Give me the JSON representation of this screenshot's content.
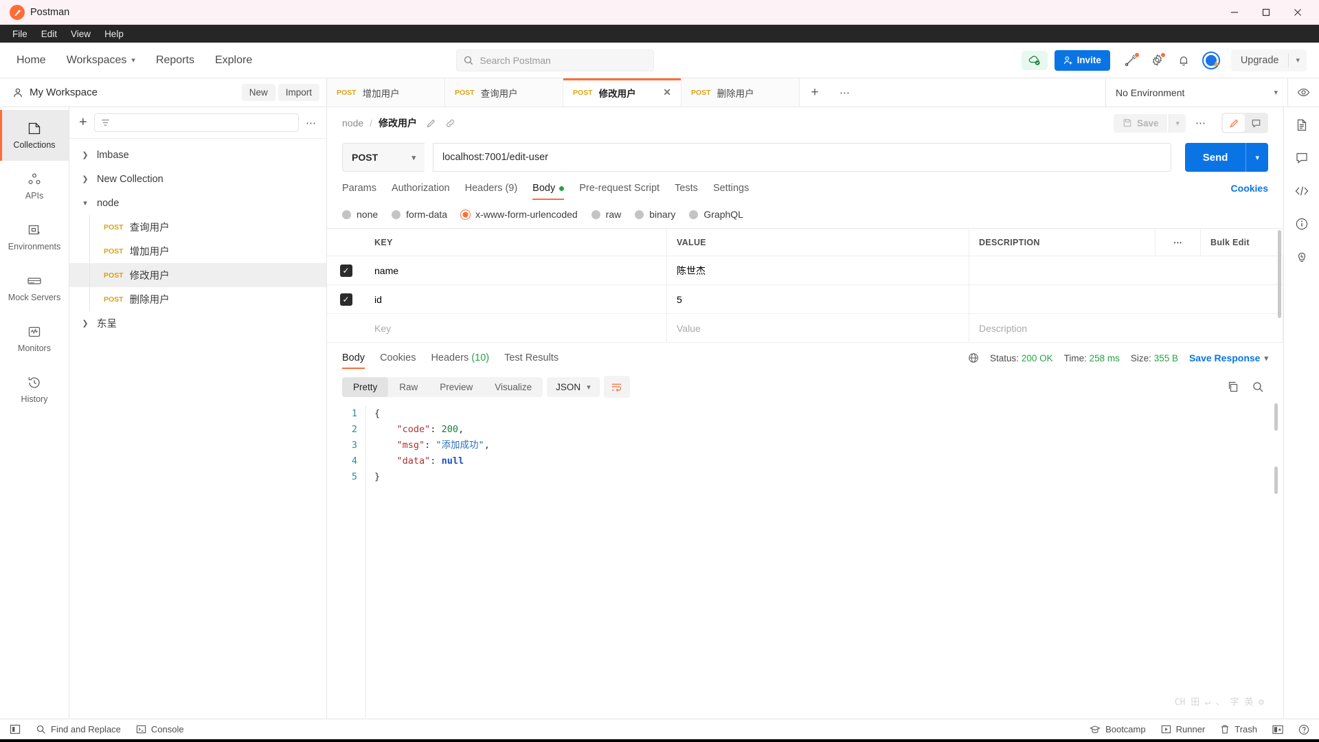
{
  "window": {
    "title": "Postman",
    "controls": {
      "minimize": "—",
      "maximize": "☐",
      "close": "✕"
    }
  },
  "menubar": {
    "items": [
      "File",
      "Edit",
      "View",
      "Help"
    ]
  },
  "topnav": {
    "links": [
      {
        "label": "Home",
        "has_caret": false
      },
      {
        "label": "Workspaces",
        "has_caret": true
      },
      {
        "label": "Reports",
        "has_caret": false
      },
      {
        "label": "Explore",
        "has_caret": false
      }
    ],
    "search": {
      "placeholder": "Search Postman",
      "value": ""
    },
    "invite_label": "Invite",
    "upgrade_label": "Upgrade",
    "icons": [
      "cloud-sync-icon",
      "broadcast-icon",
      "gear-icon",
      "bell-icon",
      "avatar-icon"
    ]
  },
  "workspace": {
    "name": "My Workspace",
    "new_label": "New",
    "import_label": "Import"
  },
  "tabs": [
    {
      "method": "POST",
      "name": "增加用户",
      "active": false
    },
    {
      "method": "POST",
      "name": "查询用户",
      "active": false
    },
    {
      "method": "POST",
      "name": "修改用户",
      "active": true
    },
    {
      "method": "POST",
      "name": "删除用户",
      "active": false
    }
  ],
  "environment": {
    "selected": "No Environment"
  },
  "left_rail": [
    {
      "label": "Collections",
      "icon": "collections-icon",
      "active": true
    },
    {
      "label": "APIs",
      "icon": "apis-icon",
      "active": false
    },
    {
      "label": "Environments",
      "icon": "environments-icon",
      "active": false
    },
    {
      "label": "Mock Servers",
      "icon": "mock-servers-icon",
      "active": false
    },
    {
      "label": "Monitors",
      "icon": "monitors-icon",
      "active": false
    },
    {
      "label": "History",
      "icon": "history-icon",
      "active": false
    }
  ],
  "sidebar": {
    "filter_placeholder": "",
    "tree": [
      {
        "type": "collection",
        "label": "lmbase",
        "expanded": false
      },
      {
        "type": "collection",
        "label": "New Collection",
        "expanded": false
      },
      {
        "type": "collection",
        "label": "node",
        "expanded": true
      },
      {
        "type": "request",
        "method": "POST",
        "label": "查询用户",
        "selected": false
      },
      {
        "type": "request",
        "method": "POST",
        "label": "增加用户",
        "selected": false
      },
      {
        "type": "request",
        "method": "POST",
        "label": "修改用户",
        "selected": true
      },
      {
        "type": "request",
        "method": "POST",
        "label": "删除用户",
        "selected": false
      },
      {
        "type": "collection",
        "label": "东呈",
        "expanded": false
      }
    ]
  },
  "request": {
    "breadcrumb_collection": "node",
    "breadcrumb_sep": "/",
    "breadcrumb_name": "修改用户",
    "save_label": "Save",
    "method": "POST",
    "url": "localhost:7001/edit-user",
    "send_label": "Send",
    "tabs": [
      {
        "label": "Params",
        "active": false,
        "dot": false
      },
      {
        "label": "Authorization",
        "active": false,
        "dot": false
      },
      {
        "label": "Headers (9)",
        "active": false,
        "dot": false
      },
      {
        "label": "Body",
        "active": true,
        "dot": true
      },
      {
        "label": "Pre-request Script",
        "active": false,
        "dot": false
      },
      {
        "label": "Tests",
        "active": false,
        "dot": false
      },
      {
        "label": "Settings",
        "active": false,
        "dot": false
      }
    ],
    "cookies_link": "Cookies",
    "body_types": [
      {
        "label": "none",
        "selected": false
      },
      {
        "label": "form-data",
        "selected": false
      },
      {
        "label": "x-www-form-urlencoded",
        "selected": true
      },
      {
        "label": "raw",
        "selected": false
      },
      {
        "label": "binary",
        "selected": false
      },
      {
        "label": "GraphQL",
        "selected": false
      }
    ],
    "table": {
      "headers": [
        "KEY",
        "VALUE",
        "DESCRIPTION"
      ],
      "bulk_edit_label": "Bulk Edit",
      "rows": [
        {
          "checked": true,
          "key": "name",
          "value": "陈世杰",
          "description": ""
        },
        {
          "checked": true,
          "key": "id",
          "value": "5",
          "description": ""
        }
      ],
      "placeholder_row": {
        "key": "Key",
        "value": "Value",
        "description": "Description"
      }
    }
  },
  "response": {
    "tabs": [
      {
        "label": "Body",
        "count": "",
        "active": true
      },
      {
        "label": "Cookies",
        "count": "",
        "active": false
      },
      {
        "label": "Headers",
        "count": "(10)",
        "active": false
      },
      {
        "label": "Test Results",
        "count": "",
        "active": false
      }
    ],
    "status_label": "Status:",
    "status_value": "200 OK",
    "time_label": "Time:",
    "time_value": "258 ms",
    "size_label": "Size:",
    "size_value": "355 B",
    "save_response_label": "Save Response",
    "viewer_tabs": [
      {
        "label": "Pretty",
        "active": true
      },
      {
        "label": "Raw",
        "active": false
      },
      {
        "label": "Preview",
        "active": false
      },
      {
        "label": "Visualize",
        "active": false
      }
    ],
    "format": "JSON",
    "body_lines": [
      {
        "n": "1",
        "segments": [
          {
            "t": "{",
            "c": "jp"
          }
        ]
      },
      {
        "n": "2",
        "segments": [
          {
            "t": "    ",
            "c": "jp"
          },
          {
            "t": "\"code\"",
            "c": "jk"
          },
          {
            "t": ": ",
            "c": "jp"
          },
          {
            "t": "200",
            "c": "jn"
          },
          {
            "t": ",",
            "c": "jp"
          }
        ]
      },
      {
        "n": "3",
        "segments": [
          {
            "t": "    ",
            "c": "jp"
          },
          {
            "t": "\"msg\"",
            "c": "jk"
          },
          {
            "t": ": ",
            "c": "jp"
          },
          {
            "t": "\"添加成功\"",
            "c": "js"
          },
          {
            "t": ",",
            "c": "jp"
          }
        ]
      },
      {
        "n": "4",
        "segments": [
          {
            "t": "    ",
            "c": "jp"
          },
          {
            "t": "\"data\"",
            "c": "jk"
          },
          {
            "t": ": ",
            "c": "jp"
          },
          {
            "t": "null",
            "c": "jnull"
          }
        ]
      },
      {
        "n": "5",
        "segments": [
          {
            "t": "}",
            "c": "jp"
          }
        ]
      }
    ]
  },
  "right_rail": [
    "document-icon",
    "comment-icon",
    "code-icon",
    "info-icon",
    "bulb-icon"
  ],
  "statusbar": {
    "left": [
      {
        "label": "",
        "icon": "sidebar-toggle-icon"
      },
      {
        "label": "Find and Replace",
        "icon": "search-icon"
      },
      {
        "label": "Console",
        "icon": "console-icon"
      }
    ],
    "right": [
      {
        "label": "Bootcamp",
        "icon": "bootcamp-icon"
      },
      {
        "label": "Runner",
        "icon": "runner-icon"
      },
      {
        "label": "Trash",
        "icon": "trash-icon"
      },
      {
        "label": "",
        "icon": "layout-icon"
      },
      {
        "label": "",
        "icon": "help-icon"
      }
    ]
  },
  "ime_hint": "CH 田 ↵ 、 字 英 ⚙"
}
